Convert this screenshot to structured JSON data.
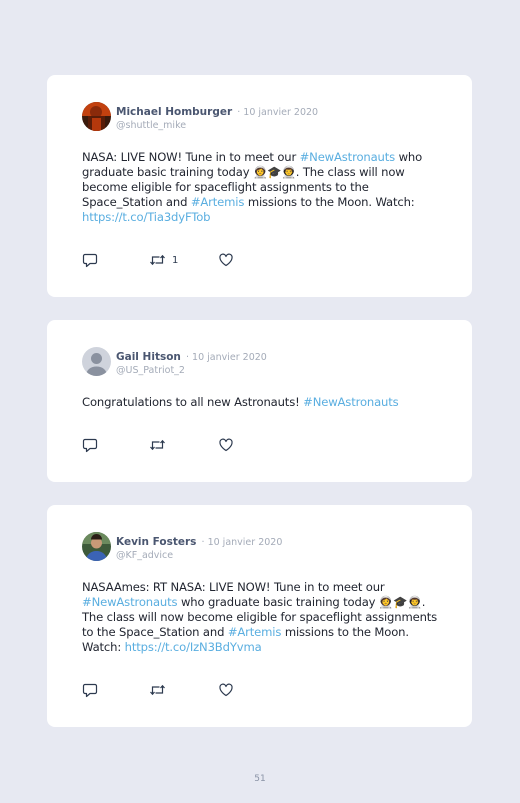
{
  "tweets": [
    {
      "name": "Michael Homburger",
      "date": "· 10 janvier 2020",
      "handle": "@shuttle_mike",
      "text_parts": [
        {
          "t": "NASA: LIVE NOW! Tune in to meet our ",
          "tag": false
        },
        {
          "t": "#NewAstronauts",
          "tag": true
        },
        {
          "t": " who graduate basic training today 👩‍🚀🎓👨‍🚀. The class will now become eligible for spaceflight assignments to the Space_Station and ",
          "tag": false
        },
        {
          "t": "#Artemis",
          "tag": true
        },
        {
          "t": " missions to the Moon. Watch: ",
          "tag": false
        },
        {
          "t": "https://t.co/Tia3dyFTob",
          "tag": true
        }
      ],
      "retweet_count": "1",
      "avatar_icon": "portrait-red-avatar"
    },
    {
      "name": "Gail Hitson",
      "date": "· 10 janvier 2020",
      "handle": "@US_Patriot_2",
      "text_parts": [
        {
          "t": "Congratulations to all new Astronauts! ",
          "tag": false
        },
        {
          "t": "#NewAstronauts",
          "tag": true
        }
      ],
      "retweet_count": "",
      "avatar_icon": "default-user-avatar"
    },
    {
      "name": "Kevin Fosters",
      "date": "· 10 janvier 2020",
      "handle": "@KF_advice",
      "text_parts": [
        {
          "t": "NASAAmes: RT NASA: LIVE NOW! Tune in to meet our ",
          "tag": false
        },
        {
          "t": "#NewAstronauts",
          "tag": true
        },
        {
          "t": " who graduate basic training today 👩‍🚀🎓👨‍🚀. The class will now become eligible for spaceflight assignments to the Space_Station and ",
          "tag": false
        },
        {
          "t": "#Artemis",
          "tag": true
        },
        {
          "t": " missions to the Moon. Watch: ",
          "tag": false
        },
        {
          "t": "https://t.co/IzN3BdYvma",
          "tag": true
        }
      ],
      "retweet_count": "",
      "avatar_icon": "man-portrait-avatar"
    }
  ],
  "icons": {
    "reply": "reply-icon",
    "retweet": "retweet-icon",
    "like": "heart-icon"
  },
  "colors": {
    "background": "#e7e9f2",
    "card": "#ffffff",
    "hashtag": "#5aaee0",
    "name": "#4a5670",
    "meta": "#a4abb8"
  },
  "page_number": "51"
}
